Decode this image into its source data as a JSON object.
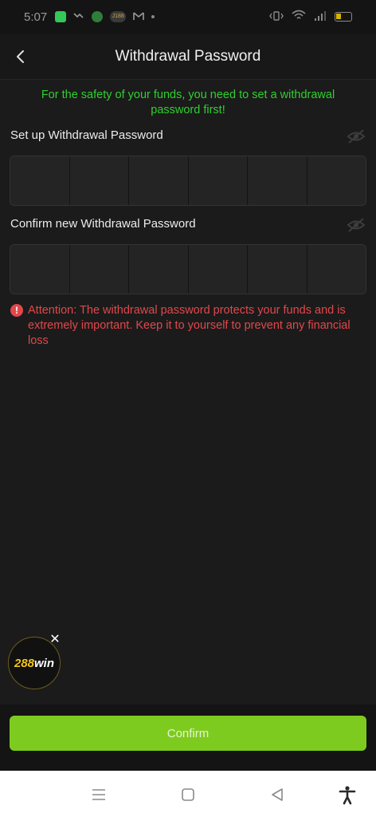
{
  "status_bar": {
    "time": "5:07",
    "badge_text": "J188"
  },
  "header": {
    "title": "Withdrawal Password",
    "back_icon": "chevron-left-icon"
  },
  "notice": "For the safety of your funds, you need to set a withdrawal password first!",
  "setup_field": {
    "label": "Set up Withdrawal Password",
    "digits": 6,
    "eye_icon": "eye-off-icon"
  },
  "confirm_field": {
    "label": "Confirm new Withdrawal Password",
    "digits": 6,
    "eye_icon": "eye-off-icon"
  },
  "attention": {
    "icon": "exclamation-circle-icon",
    "text": "Attention: The withdrawal password protects your funds and is extremely important. Keep it to yourself to prevent any financial loss"
  },
  "promo": {
    "logo_number": "288",
    "logo_word": "win",
    "close_symbol": "✕"
  },
  "confirm_button": {
    "label": "Confirm"
  },
  "colors": {
    "notice": "#2fcf2f",
    "attention": "#e2474b",
    "button": "#7ecb1f",
    "background": "#1b1b1b"
  },
  "nav_bar": {
    "icons": [
      "menu-icon",
      "home-square-icon",
      "back-triangle-icon",
      "accessibility-icon"
    ]
  }
}
